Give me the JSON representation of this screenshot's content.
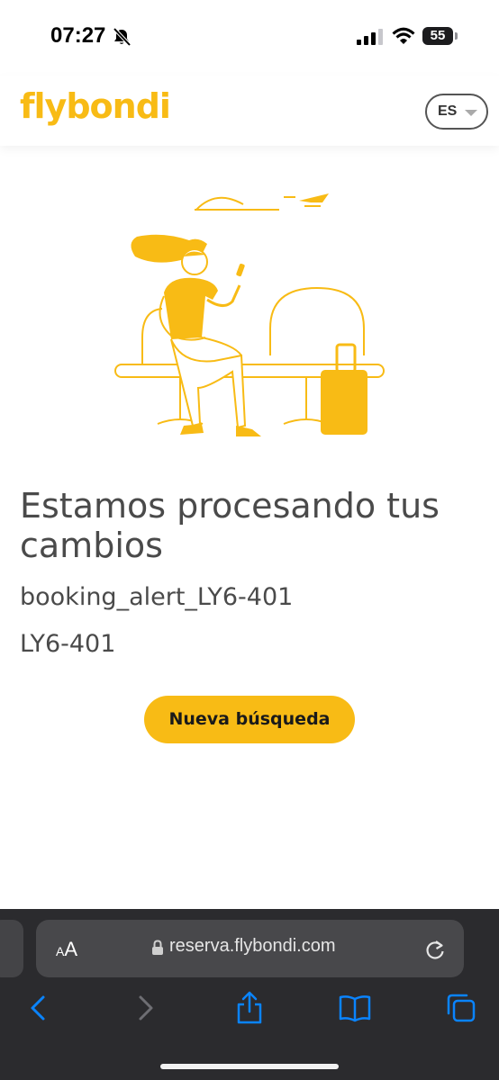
{
  "status_bar": {
    "time": "07:27",
    "battery": "55"
  },
  "header": {
    "logo": "flybondi",
    "language": "ES"
  },
  "main": {
    "title": "Estamos procesando tus cambios",
    "subtitle_1": "booking_alert_LY6-401",
    "subtitle_2": "LY6-401",
    "button_label": "Nueva búsqueda"
  },
  "browser": {
    "text_size_small": "A",
    "text_size_large": "A",
    "url": "reserva.flybondi.com"
  },
  "colors": {
    "brand_yellow": "#f8bb15",
    "text_gray": "#4a4a4a",
    "browser_bar": "#2b2b2e",
    "ios_blue": "#0a84ff"
  },
  "icons": [
    "bell-slash-icon",
    "signal-icon",
    "wifi-icon",
    "battery-icon",
    "chevron-down-icon",
    "lock-icon",
    "reload-icon",
    "back-icon",
    "forward-icon",
    "share-icon",
    "bookmarks-icon",
    "tabs-icon"
  ]
}
